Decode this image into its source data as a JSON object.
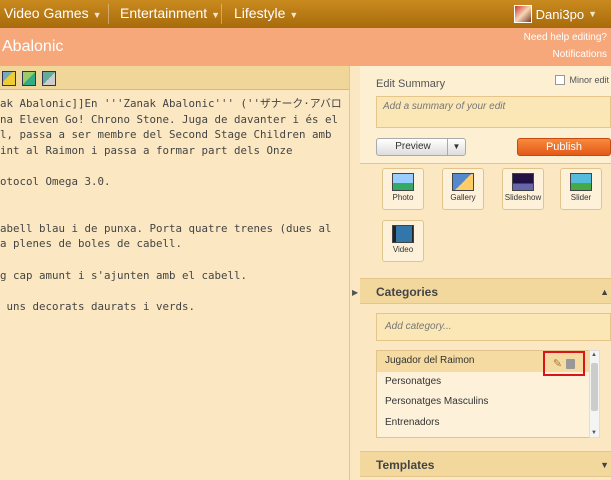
{
  "topnav": {
    "items": [
      {
        "label": "Video Games"
      },
      {
        "label": "Entertainment"
      },
      {
        "label": "Lifestyle"
      }
    ],
    "user": "Dani3po"
  },
  "header": {
    "page_title": "Abalonic",
    "help_link": "Need help editing?",
    "notifications": "Notifications"
  },
  "editor": {
    "lines": [
      "ak Abalonic]]En '''Zanak Abalonic''' (''ザナーク·アバロ",
      "na Eleven Go! Chrono Stone. Juga de davanter i és el",
      "l, passa a ser membre del Second Stage Children amb",
      "int al Raimon i passa a formar part dels Onze",
      "",
      "otocol Omega 3.0.",
      "",
      "",
      "abell blau i de punxa. Porta quatre trenes (dues al",
      "a plenes de boles de cabell.",
      "",
      "g cap amunt i s'ajunten amb el cabell.",
      "",
      " uns decorats daurats i verds."
    ]
  },
  "rail": {
    "edit_summary_label": "Edit Summary",
    "minor_edit_label": "Minor edit",
    "summary_placeholder": "Add a summary of your edit",
    "preview_label": "Preview",
    "publish_label": "Publish",
    "media": [
      {
        "label": "Photo",
        "icon": "photo-icon"
      },
      {
        "label": "Gallery",
        "icon": "gallery-icon"
      },
      {
        "label": "Slideshow",
        "icon": "slideshow-icon"
      },
      {
        "label": "Slider",
        "icon": "slider-icon"
      },
      {
        "label": "Video",
        "icon": "video-icon"
      }
    ],
    "categories_title": "Categories",
    "category_placeholder": "Add category...",
    "categories": [
      "Jugador del Raimon",
      "Personatges",
      "Personatges Masculins",
      "Entrenadors"
    ],
    "templates_title": "Templates"
  },
  "colors": {
    "nav": "#b5770f",
    "title_bar": "#f6a87a",
    "publish": "#e8611f",
    "highlight_box": "#d9141a"
  }
}
